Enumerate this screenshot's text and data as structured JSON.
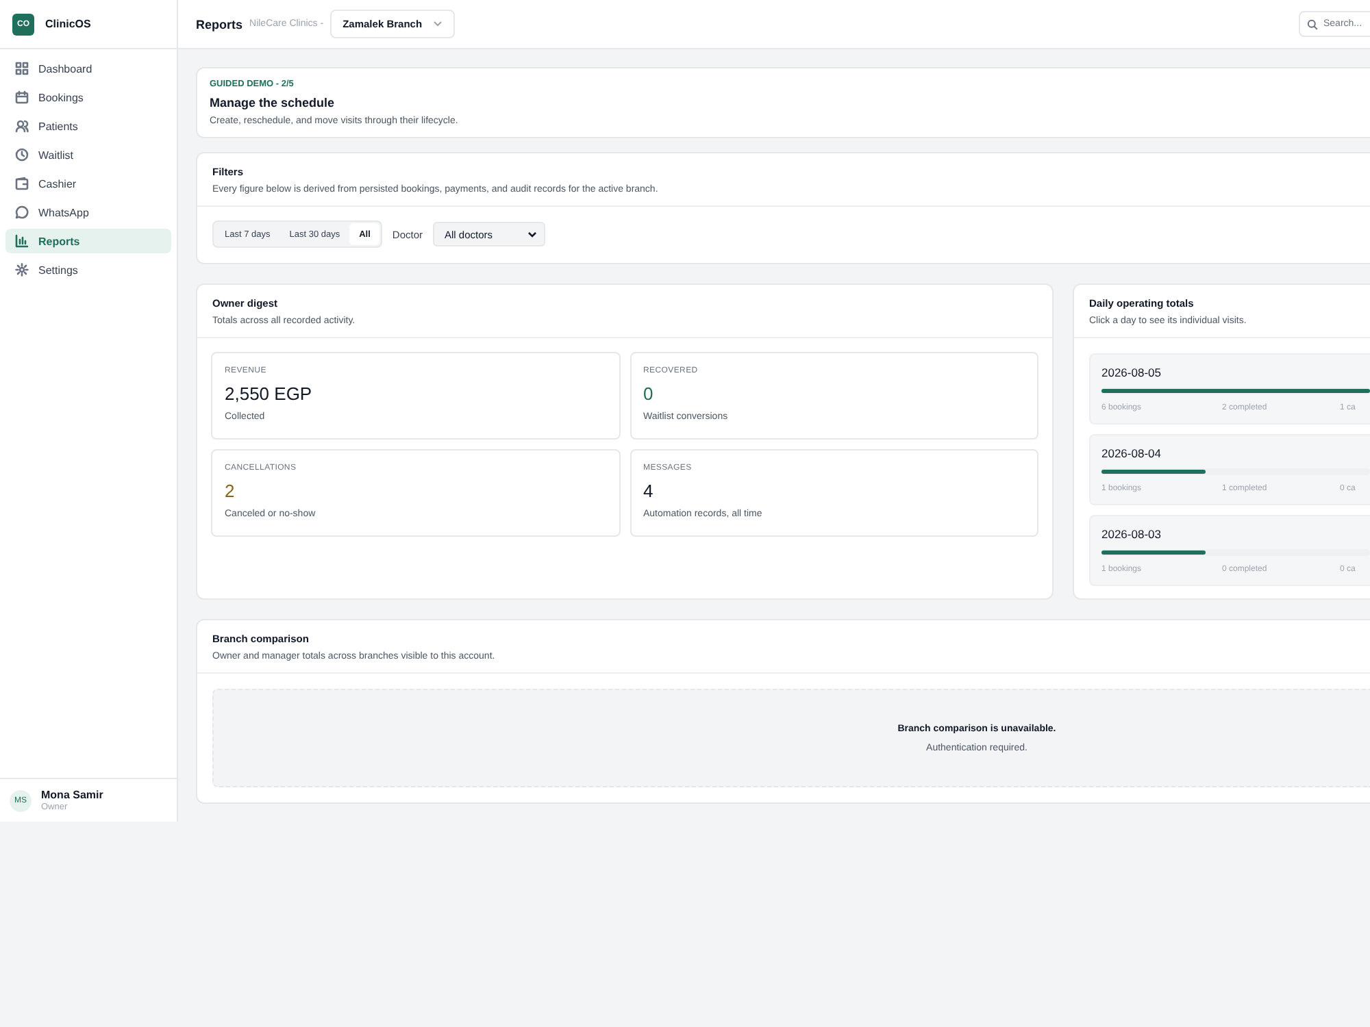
{
  "app": {
    "logo": "CO",
    "name": "ClinicOS"
  },
  "sidebar": {
    "items": [
      {
        "label": "Dashboard",
        "selected": false
      },
      {
        "label": "Bookings",
        "selected": false
      },
      {
        "label": "Patients",
        "selected": false
      },
      {
        "label": "Waitlist",
        "selected": false
      },
      {
        "label": "Cashier",
        "selected": false
      },
      {
        "label": "WhatsApp",
        "selected": false
      },
      {
        "label": "Reports",
        "selected": true
      },
      {
        "label": "Settings",
        "selected": false
      }
    ],
    "user": {
      "initials": "MS",
      "name": "Mona Samir",
      "role": "Owner"
    }
  },
  "topbar": {
    "title": "Reports",
    "org": "NileCare Clinics -",
    "branch": "Zamalek Branch",
    "search": {
      "placeholder": "Search..."
    }
  },
  "guide": {
    "step": "GUIDED DEMO - 2/5",
    "title": "Manage the schedule",
    "text": "Create, reschedule, and move visits through their lifecycle."
  },
  "filters": {
    "title": "Filters",
    "text": "Every figure below is derived from persisted bookings, payments, and audit records for the active branch.",
    "ranges": [
      {
        "label": "Last 7 days",
        "selected": false
      },
      {
        "label": "Last 30 days",
        "selected": false
      },
      {
        "label": "All",
        "selected": true
      }
    ],
    "doctor_label": "Doctor",
    "doctor": "All doctors"
  },
  "digest": {
    "title": "Owner digest",
    "text": "Totals across all recorded activity.",
    "metrics": [
      {
        "label": "REVENUE",
        "value": "2,550 EGP",
        "note": "Collected",
        "color": "#111827"
      },
      {
        "label": "RECOVERED",
        "value": "0",
        "note": "Waitlist conversions",
        "color": "#1f6f5c"
      },
      {
        "label": "CANCELLATIONS",
        "value": "2",
        "note": "Canceled or no-show",
        "color": "#8a6416"
      },
      {
        "label": "MESSAGES",
        "value": "4",
        "note": "Automation records, all time",
        "color": "#111827"
      }
    ]
  },
  "daily": {
    "title": "Daily operating totals",
    "text": "Click a day to see its individual visits.",
    "days": [
      {
        "date": "2026-08-05",
        "level": 1,
        "bookings": "6 bookings",
        "completed": "2 completed",
        "column_3": "1 ca"
      },
      {
        "date": "2026-08-04",
        "level": 0.39,
        "bookings": "1 bookings",
        "completed": "1 completed",
        "column_3": "0 ca"
      },
      {
        "date": "2026-08-03",
        "level": 0.39,
        "bookings": "1 bookings",
        "completed": "0 completed",
        "column_3": "0 ca"
      }
    ]
  },
  "branch": {
    "title": "Branch comparison",
    "text": "Owner and manager totals across branches visible to this account.",
    "empty_title": "Branch comparison is unavailable.",
    "empty_text": "Authentication required."
  }
}
